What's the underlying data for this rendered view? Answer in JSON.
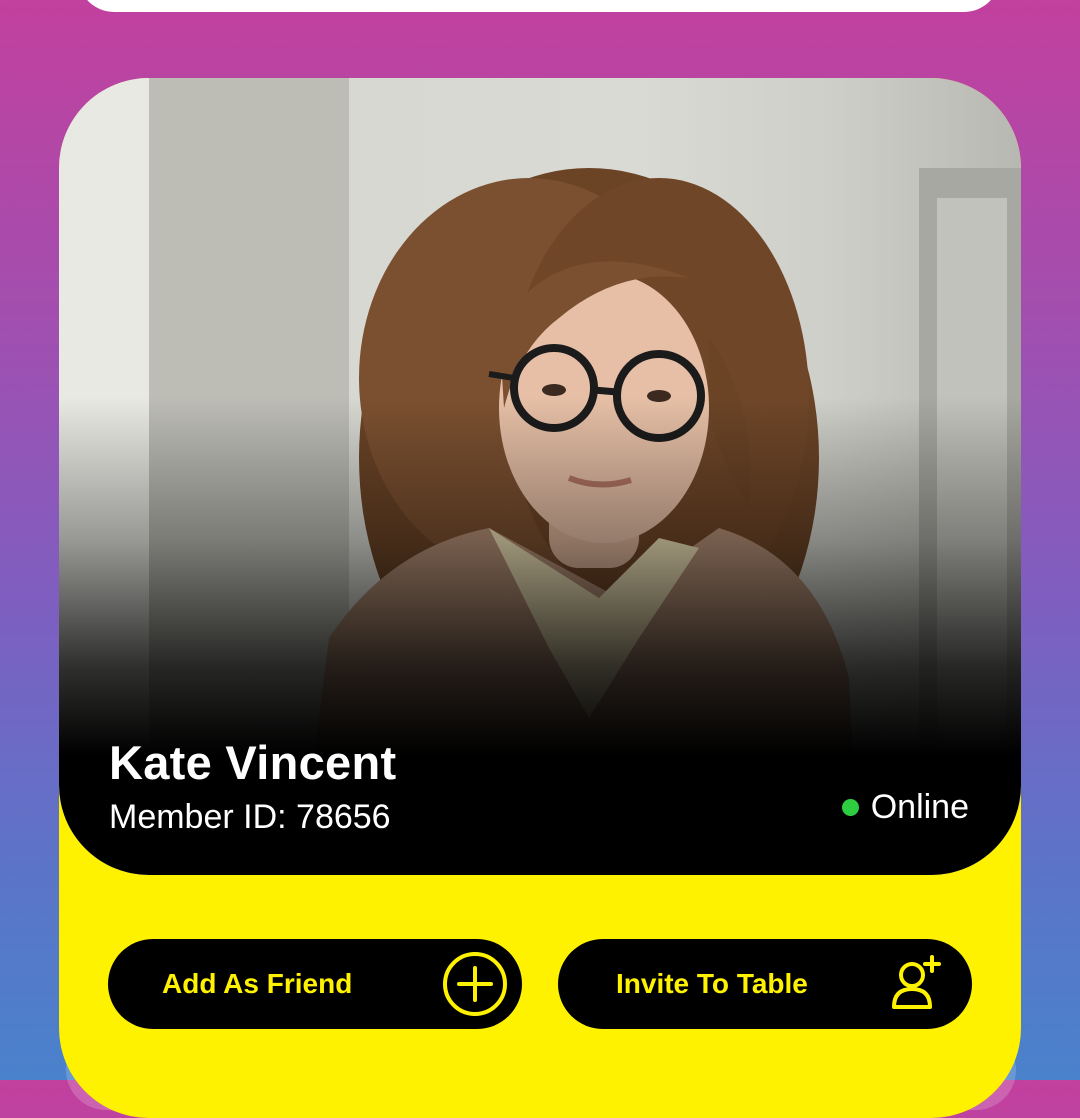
{
  "profile": {
    "name": "Kate Vincent",
    "member_id": "Member ID: 78656",
    "status": "Online"
  },
  "actions": {
    "add_friend_label": "Add As Friend",
    "invite_label": "Invite To Table"
  },
  "icons": {
    "add_friend": "plus-circle-icon",
    "invite": "user-plus-icon",
    "status": "online-dot-icon"
  },
  "colors": {
    "accent": "#fff200",
    "button_bg": "#000000",
    "online": "#2ecc40",
    "text_primary": "#ffffff"
  }
}
